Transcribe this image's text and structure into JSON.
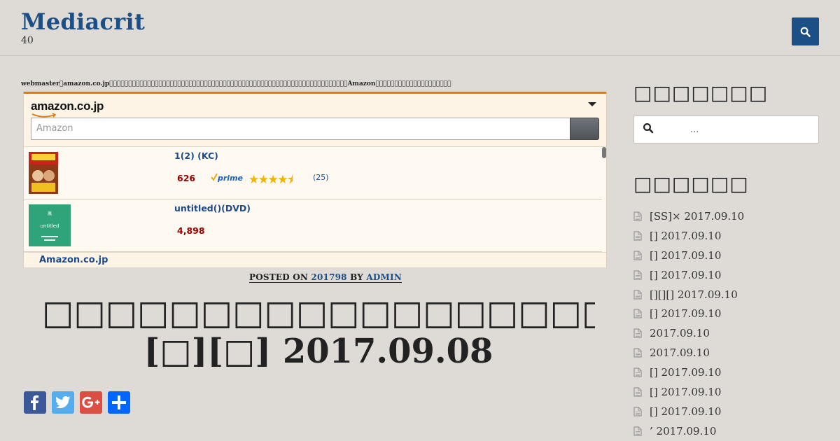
{
  "site": {
    "title": "Mediacrit",
    "tagline": "40"
  },
  "header": {
    "search_icon": "search-icon"
  },
  "notice": "webmaster\u0000amazon.co.jp\u0000\u0000\u0000\u0000\u0000\u0000\u0000\u0000\u0000\u0000\u0000\u0000\u0000\u0000\u0000\u0000\u0000\u0000\u0000\u0000\u0000\u0000\u0000\u0000\u0000\u0000\u0000\u0000\u0000\u0000\u0000\u0000\u0000\u0000\u0000\u0000\u0000\u0000\u0000\u0000\u0000\u0000\u0000\u0000\u0000\u0000\u0000\u0000\u0000\u0000\u0000\u0000\u0000\u0000\u0000\u0000\u0000\u0000\u0000\u0000\u0000\u0000\u0000Amazon\u0000\u0000\u0000\u0000\u0000\u0000\u0000\u0000\u0000\u0000\u0000\u0000\u0000\u0000\u0000\u0000\u0000\u0000\u0000\u0000",
  "amazon": {
    "logo": "amazon.co.jp",
    "search_placeholder": "Amazon",
    "items": [
      {
        "title": "1(2) (KC)",
        "price": "626",
        "prime": "prime",
        "rating": 4.5,
        "stars": "★★★★⯨",
        "reviews": "(25)"
      },
      {
        "title": "untitled()(DVD)",
        "price": "4,898",
        "thumb_text": "untitled",
        "thumb_top": "嵐"
      }
    ],
    "footer_link": "Amazon.co.jp",
    "brand_color": "#e47911"
  },
  "post": {
    "meta_prefix": "POSTED ON",
    "date": "201798",
    "meta_by": "BY",
    "author": "ADMIN",
    "title_line1": "□□□□□□□□□□□□□□□□□□□□□□□□□□□□□□□□",
    "title_line2": "[□][□] 2017.09.08"
  },
  "share": {
    "buttons": [
      {
        "name": "facebook",
        "icon": "facebook-icon",
        "color": "#3b5998"
      },
      {
        "name": "twitter",
        "icon": "twitter-icon",
        "color": "#55acee"
      },
      {
        "name": "google-plus",
        "icon": "google-plus-icon",
        "color": "#dc4e41"
      },
      {
        "name": "share",
        "icon": "plus-icon",
        "color": "#0166ff"
      }
    ]
  },
  "sidebar": {
    "search_title": "□□□□□□□",
    "search_placeholder": "...",
    "recent_title": "□□□□□□",
    "recent_posts": [
      "[SS]× 2017.09.10",
      "[] 2017.09.10",
      "[] 2017.09.10",
      "[] 2017.09.10",
      "[][][] 2017.09.10",
      "[] 2017.09.10",
      " 2017.09.10",
      " 2017.09.10",
      "[] 2017.09.10",
      "[] 2017.09.10",
      "[] 2017.09.10",
      "’ 2017.09.10"
    ]
  },
  "colors": {
    "accent": "#1c4f86",
    "background": "#dedad6"
  }
}
